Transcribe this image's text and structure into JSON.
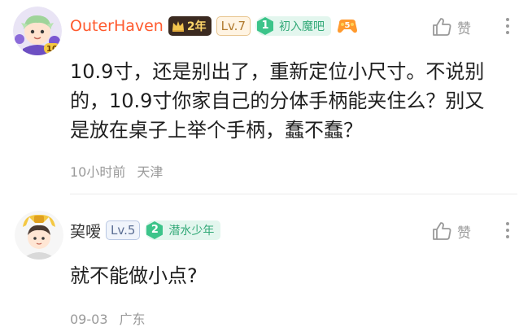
{
  "comments": [
    {
      "username": "OuterHaven",
      "years_badge": "2年",
      "level": "Lv.7",
      "fan_level": "1",
      "fan_title": "初入魔吧",
      "game_badge_number": "5",
      "avatar_badge_number": "10",
      "like_label": "赞",
      "content": "10.9寸，还是别出了，重新定位小尺寸。不说别的，10.9寸你家自己的分体手柄能夹住么？别又是放在桌子上举个手柄，蠢不蠢？",
      "time": "10小时前",
      "location": "天津"
    },
    {
      "username": "巭嗳",
      "level": "Lv.5",
      "fan_level": "2",
      "fan_title": "潜水少年",
      "like_label": "赞",
      "content": "就不能做小点?",
      "time": "09-03",
      "location": "广东"
    }
  ],
  "colors": {
    "vip_name": "#ff5a2e",
    "fan_green": "#33a978",
    "meta_gray": "#9a9a9a"
  }
}
